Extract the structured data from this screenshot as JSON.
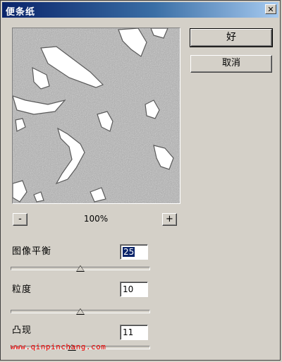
{
  "window": {
    "title": "便条纸",
    "close_glyph": "✕"
  },
  "buttons": {
    "ok_label": "好",
    "cancel_label": "取消"
  },
  "zoom": {
    "minus_label": "-",
    "plus_label": "+",
    "level": "100%"
  },
  "params": [
    {
      "label": "图像平衡",
      "value": "25",
      "slider_fraction": 0.5
    },
    {
      "label": "粒度",
      "value": "10",
      "slider_fraction": 0.5
    },
    {
      "label": "凸现",
      "value": "11",
      "slider_fraction": 0.44
    }
  ],
  "watermark": "www.qinpinchang.com",
  "colors": {
    "dialog_bg": "#d4d0c8",
    "title_start": "#0a246a",
    "title_end": "#a6caf0",
    "selection": "#0a246a",
    "watermark": "#ee0000"
  },
  "icons": {
    "close": "close-icon",
    "preview": "note-paper-preview"
  }
}
